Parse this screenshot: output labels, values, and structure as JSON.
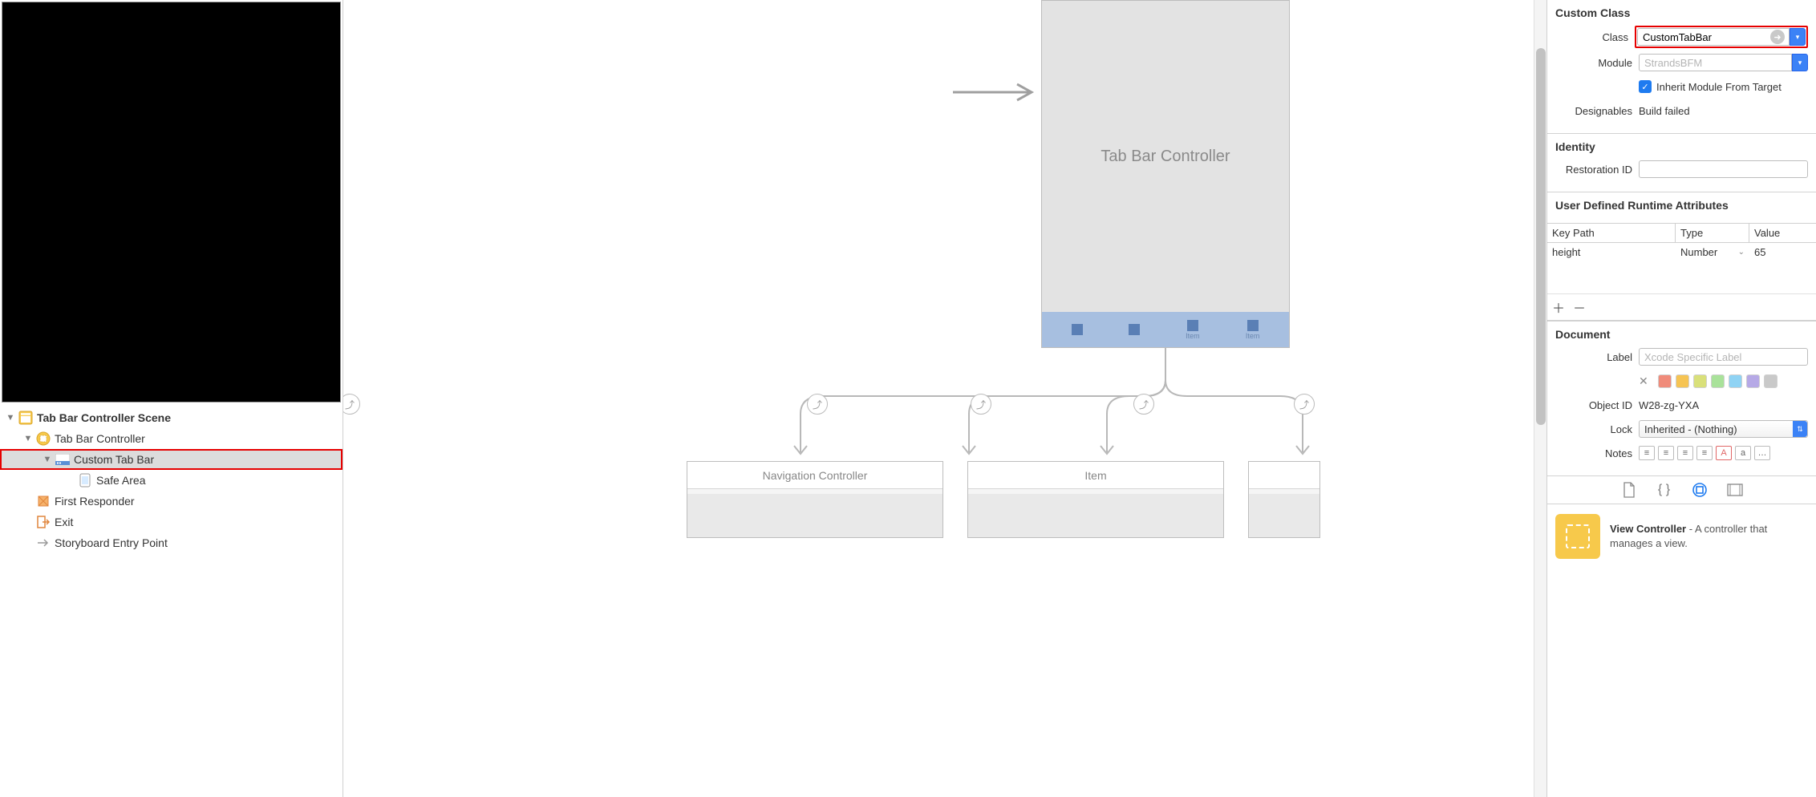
{
  "navigator": {
    "scene_title": "Tab Bar Controller Scene",
    "items": {
      "tab_bar_controller": "Tab Bar Controller",
      "custom_tab_bar": "Custom Tab Bar",
      "safe_area": "Safe Area",
      "first_responder": "First Responder",
      "exit": "Exit",
      "entry_point": "Storyboard Entry Point"
    }
  },
  "canvas": {
    "tbc_title": "Tab Bar Controller",
    "tab_items": [
      {
        "label": ""
      },
      {
        "label": ""
      },
      {
        "label": "Item"
      },
      {
        "label": "Item"
      }
    ],
    "children": [
      {
        "title": "Navigation Controller"
      },
      {
        "title": "Item"
      },
      {
        "title": ""
      }
    ]
  },
  "inspector": {
    "custom_class": {
      "section": "Custom Class",
      "class_label": "Class",
      "class_value": "CustomTabBar",
      "module_label": "Module",
      "module_placeholder": "StrandsBFM",
      "inherit_label": "Inherit Module From Target",
      "designables_label": "Designables",
      "designables_value": "Build failed"
    },
    "identity": {
      "section": "Identity",
      "restoration_label": "Restoration ID"
    },
    "runtime": {
      "section": "User Defined Runtime Attributes",
      "headers": {
        "key": "Key Path",
        "type": "Type",
        "value": "Value"
      },
      "row": {
        "key": "height",
        "type": "Number",
        "value": "65"
      }
    },
    "document": {
      "section": "Document",
      "label_label": "Label",
      "label_placeholder": "Xcode Specific Label",
      "object_id_label": "Object ID",
      "object_id_value": "W28-zg-YXA",
      "lock_label": "Lock",
      "lock_value": "Inherited - (Nothing)",
      "notes_label": "Notes",
      "swatches": [
        "#f08b7a",
        "#f6c453",
        "#d9e07a",
        "#a9e29a",
        "#8fd3f4",
        "#b6a9e6",
        "#c9c9c9"
      ]
    },
    "library": {
      "item_title": "View Controller",
      "item_desc": " - A controller that manages a view."
    }
  }
}
